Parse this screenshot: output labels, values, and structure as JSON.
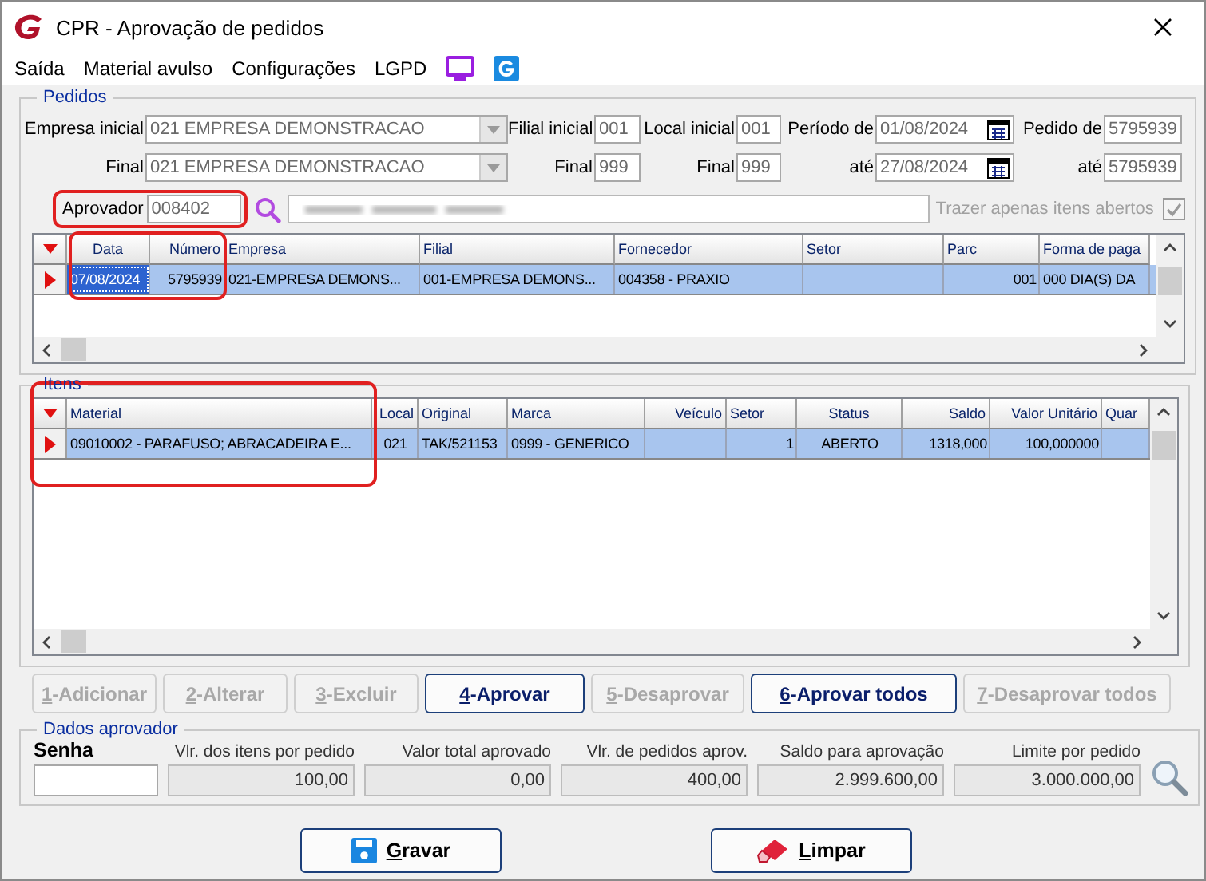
{
  "window": {
    "title": "CPR - Aprovação de pedidos"
  },
  "menu": [
    {
      "label": "Saída"
    },
    {
      "label": "Material avulso"
    },
    {
      "label": "Configurações"
    },
    {
      "label": "LGPD"
    }
  ],
  "pedidos": {
    "title": "Pedidos",
    "filter_rows": [
      [
        {
          "label": "Empresa inicial",
          "value": "021 EMPRESA DEMONSTRACAO",
          "kind": "combo"
        },
        {
          "label": "Filial inicial",
          "value": "001",
          "kind": "text"
        },
        {
          "label": "Local inicial",
          "value": "001",
          "kind": "text"
        },
        {
          "label": "Período de",
          "value": "01/08/2024",
          "kind": "date"
        },
        {
          "label": "Pedido de",
          "value": "5795939",
          "kind": "text"
        }
      ],
      [
        {
          "label": "Final",
          "value": "021 EMPRESA DEMONSTRACAO",
          "kind": "combo"
        },
        {
          "label": "Final",
          "value": "999",
          "kind": "text"
        },
        {
          "label": "Final",
          "value": "999",
          "kind": "text"
        },
        {
          "label": "até",
          "value": "27/08/2024",
          "kind": "date"
        },
        {
          "label": "até",
          "value": "5795939",
          "kind": "text"
        }
      ]
    ],
    "aprovador": {
      "label": "Aprovador",
      "value": "008402"
    },
    "only_open": {
      "label": "Trazer apenas itens abertos",
      "checked": true,
      "disabled": true
    },
    "grid": {
      "columns": [
        "Data",
        "Número",
        "Empresa",
        "Filial",
        "Fornecedor",
        "Setor",
        "Parc",
        "Forma de paga"
      ],
      "rows": [
        {
          "selected": true,
          "cells": [
            {
              "text": "07/08/2024",
              "focused": true
            },
            {
              "text": "5795939",
              "focused": false
            },
            {
              "text": "021-EMPRESA DEMONS...",
              "focused": false
            },
            {
              "text": "001-EMPRESA DEMONS...",
              "focused": false
            },
            {
              "text": "004358 - PRAXIO",
              "focused": false
            },
            {
              "focused": false
            },
            {
              "text": "001",
              "focused": false
            },
            {
              "text": "000  DIA(S) DA",
              "focused": false
            }
          ]
        }
      ]
    }
  },
  "itens": {
    "title": "Itens",
    "grid": {
      "columns": [
        "Material",
        "Local",
        "Original",
        "Marca",
        "Veículo",
        "Setor",
        "Status",
        "Saldo",
        "Valor Unitário",
        "Quar"
      ],
      "rows": [
        {
          "selected": true,
          "cells": [
            {
              "text": "09010002 - PARAFUSO; ABRACADEIRA E...",
              "focused": false
            },
            {
              "text": "021",
              "focused": false
            },
            {
              "text": "TAK/521153",
              "focused": false
            },
            {
              "text": "0999 - GENERICO",
              "focused": false
            },
            {
              "focused": false
            },
            {
              "text": "1",
              "focused": false
            },
            {
              "text": "ABERTO",
              "focused": false
            },
            {
              "text": "1318,000",
              "focused": false
            },
            {
              "text": "100,000000",
              "focused": false
            },
            {
              "focused": false
            }
          ]
        }
      ]
    }
  },
  "actions": [
    {
      "label": "1-Adicionar",
      "disabled": true
    },
    {
      "label": "2-Alterar",
      "disabled": true
    },
    {
      "label": "3-Excluir",
      "disabled": true
    },
    {
      "label": "4-Aprovar",
      "disabled": false
    },
    {
      "label": "5-Desaprovar",
      "disabled": true
    },
    {
      "label": "6-Aprovar todos",
      "disabled": false
    },
    {
      "label": "7-Desaprovar todos",
      "disabled": true
    }
  ],
  "dados_aprovador": {
    "title": "Dados aprovador",
    "senha": {
      "label": "Senha"
    },
    "totals": [
      {
        "label": "Vlr. dos itens por pedido",
        "value": "100,00"
      },
      {
        "label": "Valor total aprovado",
        "value": "0,00"
      },
      {
        "label": "Vlr. de pedidos aprov.",
        "value": "400,00"
      },
      {
        "label": "Saldo para aprovação",
        "value": "2.999.600,00"
      },
      {
        "label": "Limite por pedido",
        "value": "3.000.000,00"
      }
    ]
  },
  "footer_buttons": [
    {
      "label": "Gravar",
      "kind": "save"
    },
    {
      "label": "Limpar",
      "kind": "clear"
    }
  ]
}
